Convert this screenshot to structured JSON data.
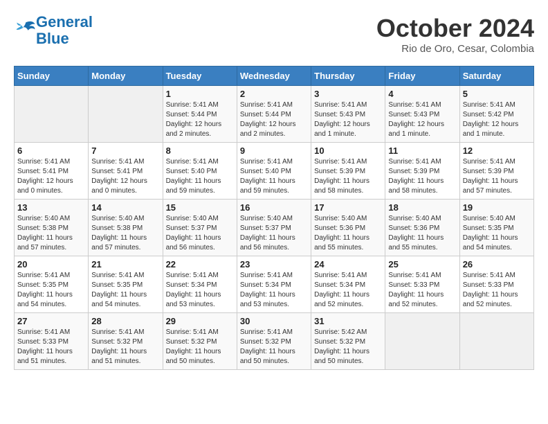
{
  "header": {
    "logo_line1": "General",
    "logo_line2": "Blue",
    "month": "October 2024",
    "location": "Rio de Oro, Cesar, Colombia"
  },
  "weekdays": [
    "Sunday",
    "Monday",
    "Tuesday",
    "Wednesday",
    "Thursday",
    "Friday",
    "Saturday"
  ],
  "weeks": [
    [
      {
        "day": "",
        "info": ""
      },
      {
        "day": "",
        "info": ""
      },
      {
        "day": "1",
        "info": "Sunrise: 5:41 AM\nSunset: 5:44 PM\nDaylight: 12 hours\nand 2 minutes."
      },
      {
        "day": "2",
        "info": "Sunrise: 5:41 AM\nSunset: 5:44 PM\nDaylight: 12 hours\nand 2 minutes."
      },
      {
        "day": "3",
        "info": "Sunrise: 5:41 AM\nSunset: 5:43 PM\nDaylight: 12 hours\nand 1 minute."
      },
      {
        "day": "4",
        "info": "Sunrise: 5:41 AM\nSunset: 5:43 PM\nDaylight: 12 hours\nand 1 minute."
      },
      {
        "day": "5",
        "info": "Sunrise: 5:41 AM\nSunset: 5:42 PM\nDaylight: 12 hours\nand 1 minute."
      }
    ],
    [
      {
        "day": "6",
        "info": "Sunrise: 5:41 AM\nSunset: 5:41 PM\nDaylight: 12 hours\nand 0 minutes."
      },
      {
        "day": "7",
        "info": "Sunrise: 5:41 AM\nSunset: 5:41 PM\nDaylight: 12 hours\nand 0 minutes."
      },
      {
        "day": "8",
        "info": "Sunrise: 5:41 AM\nSunset: 5:40 PM\nDaylight: 11 hours\nand 59 minutes."
      },
      {
        "day": "9",
        "info": "Sunrise: 5:41 AM\nSunset: 5:40 PM\nDaylight: 11 hours\nand 59 minutes."
      },
      {
        "day": "10",
        "info": "Sunrise: 5:41 AM\nSunset: 5:39 PM\nDaylight: 11 hours\nand 58 minutes."
      },
      {
        "day": "11",
        "info": "Sunrise: 5:41 AM\nSunset: 5:39 PM\nDaylight: 11 hours\nand 58 minutes."
      },
      {
        "day": "12",
        "info": "Sunrise: 5:41 AM\nSunset: 5:39 PM\nDaylight: 11 hours\nand 57 minutes."
      }
    ],
    [
      {
        "day": "13",
        "info": "Sunrise: 5:40 AM\nSunset: 5:38 PM\nDaylight: 11 hours\nand 57 minutes."
      },
      {
        "day": "14",
        "info": "Sunrise: 5:40 AM\nSunset: 5:38 PM\nDaylight: 11 hours\nand 57 minutes."
      },
      {
        "day": "15",
        "info": "Sunrise: 5:40 AM\nSunset: 5:37 PM\nDaylight: 11 hours\nand 56 minutes."
      },
      {
        "day": "16",
        "info": "Sunrise: 5:40 AM\nSunset: 5:37 PM\nDaylight: 11 hours\nand 56 minutes."
      },
      {
        "day": "17",
        "info": "Sunrise: 5:40 AM\nSunset: 5:36 PM\nDaylight: 11 hours\nand 55 minutes."
      },
      {
        "day": "18",
        "info": "Sunrise: 5:40 AM\nSunset: 5:36 PM\nDaylight: 11 hours\nand 55 minutes."
      },
      {
        "day": "19",
        "info": "Sunrise: 5:40 AM\nSunset: 5:35 PM\nDaylight: 11 hours\nand 54 minutes."
      }
    ],
    [
      {
        "day": "20",
        "info": "Sunrise: 5:41 AM\nSunset: 5:35 PM\nDaylight: 11 hours\nand 54 minutes."
      },
      {
        "day": "21",
        "info": "Sunrise: 5:41 AM\nSunset: 5:35 PM\nDaylight: 11 hours\nand 54 minutes."
      },
      {
        "day": "22",
        "info": "Sunrise: 5:41 AM\nSunset: 5:34 PM\nDaylight: 11 hours\nand 53 minutes."
      },
      {
        "day": "23",
        "info": "Sunrise: 5:41 AM\nSunset: 5:34 PM\nDaylight: 11 hours\nand 53 minutes."
      },
      {
        "day": "24",
        "info": "Sunrise: 5:41 AM\nSunset: 5:34 PM\nDaylight: 11 hours\nand 52 minutes."
      },
      {
        "day": "25",
        "info": "Sunrise: 5:41 AM\nSunset: 5:33 PM\nDaylight: 11 hours\nand 52 minutes."
      },
      {
        "day": "26",
        "info": "Sunrise: 5:41 AM\nSunset: 5:33 PM\nDaylight: 11 hours\nand 52 minutes."
      }
    ],
    [
      {
        "day": "27",
        "info": "Sunrise: 5:41 AM\nSunset: 5:33 PM\nDaylight: 11 hours\nand 51 minutes."
      },
      {
        "day": "28",
        "info": "Sunrise: 5:41 AM\nSunset: 5:32 PM\nDaylight: 11 hours\nand 51 minutes."
      },
      {
        "day": "29",
        "info": "Sunrise: 5:41 AM\nSunset: 5:32 PM\nDaylight: 11 hours\nand 50 minutes."
      },
      {
        "day": "30",
        "info": "Sunrise: 5:41 AM\nSunset: 5:32 PM\nDaylight: 11 hours\nand 50 minutes."
      },
      {
        "day": "31",
        "info": "Sunrise: 5:42 AM\nSunset: 5:32 PM\nDaylight: 11 hours\nand 50 minutes."
      },
      {
        "day": "",
        "info": ""
      },
      {
        "day": "",
        "info": ""
      }
    ]
  ]
}
